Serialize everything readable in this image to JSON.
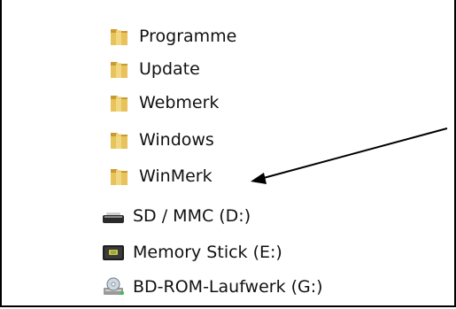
{
  "folders": [
    {
      "label": "Programme",
      "icon": "folder-icon"
    },
    {
      "label": "Update",
      "icon": "folder-icon"
    },
    {
      "label": "Webmerk",
      "icon": "folder-icon"
    },
    {
      "label": "Windows",
      "icon": "folder-icon"
    },
    {
      "label": "WinMerk",
      "icon": "folder-icon"
    }
  ],
  "drives": [
    {
      "label": "SD / MMC (D:)",
      "icon": "card-reader-drive-icon"
    },
    {
      "label": "Memory Stick (E:)",
      "icon": "memory-stick-drive-icon"
    },
    {
      "label": "BD-ROM-Laufwerk (G:)",
      "icon": "optical-drive-icon"
    }
  ],
  "colors": {
    "folder": "#e8c25a",
    "folder_dark": "#c99a2e",
    "arrow": "#000000"
  }
}
